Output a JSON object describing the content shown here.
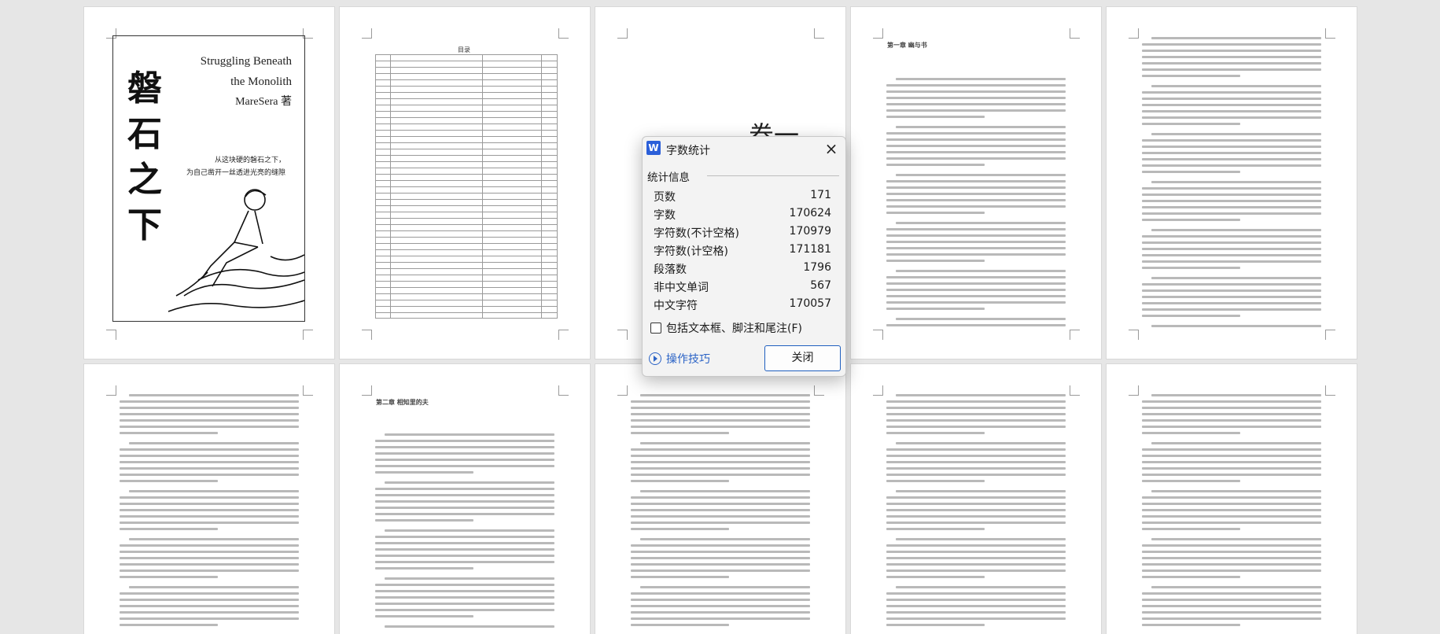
{
  "cover": {
    "title_cn": "磐石之下",
    "title_en_line1": "Struggling Beneath",
    "title_en_line2": "the Monolith",
    "author": "MareSera 著",
    "tagline_line1": "从这块硬的磐石之下，",
    "tagline_line2": "为自己凿开一丝透进光亮的缝隙"
  },
  "toc": {
    "title": "目录"
  },
  "chapter_heading_partial": "卷一",
  "chapter_titles": {
    "p1_4": "第一章  幽与书",
    "p2_2": "第二章  相知里的夫"
  },
  "dialog": {
    "app_icon": "W",
    "title": "字数统计",
    "close_icon": "×",
    "section_label": "统计信息",
    "stats": [
      {
        "label": "页数",
        "value": "171"
      },
      {
        "label": "字数",
        "value": "170624"
      },
      {
        "label": "字符数(不计空格)",
        "value": "170979"
      },
      {
        "label": "字符数(计空格)",
        "value": "171181"
      },
      {
        "label": "段落数",
        "value": "1796"
      },
      {
        "label": "非中文单词",
        "value": "567"
      },
      {
        "label": "中文字符",
        "value": "170057"
      }
    ],
    "checkbox_label": "包括文本框、脚注和尾注(F)",
    "checkbox_checked": false,
    "tips_label": "操作技巧",
    "close_button_label": "关闭",
    "accent_color": "#2b63c6"
  }
}
